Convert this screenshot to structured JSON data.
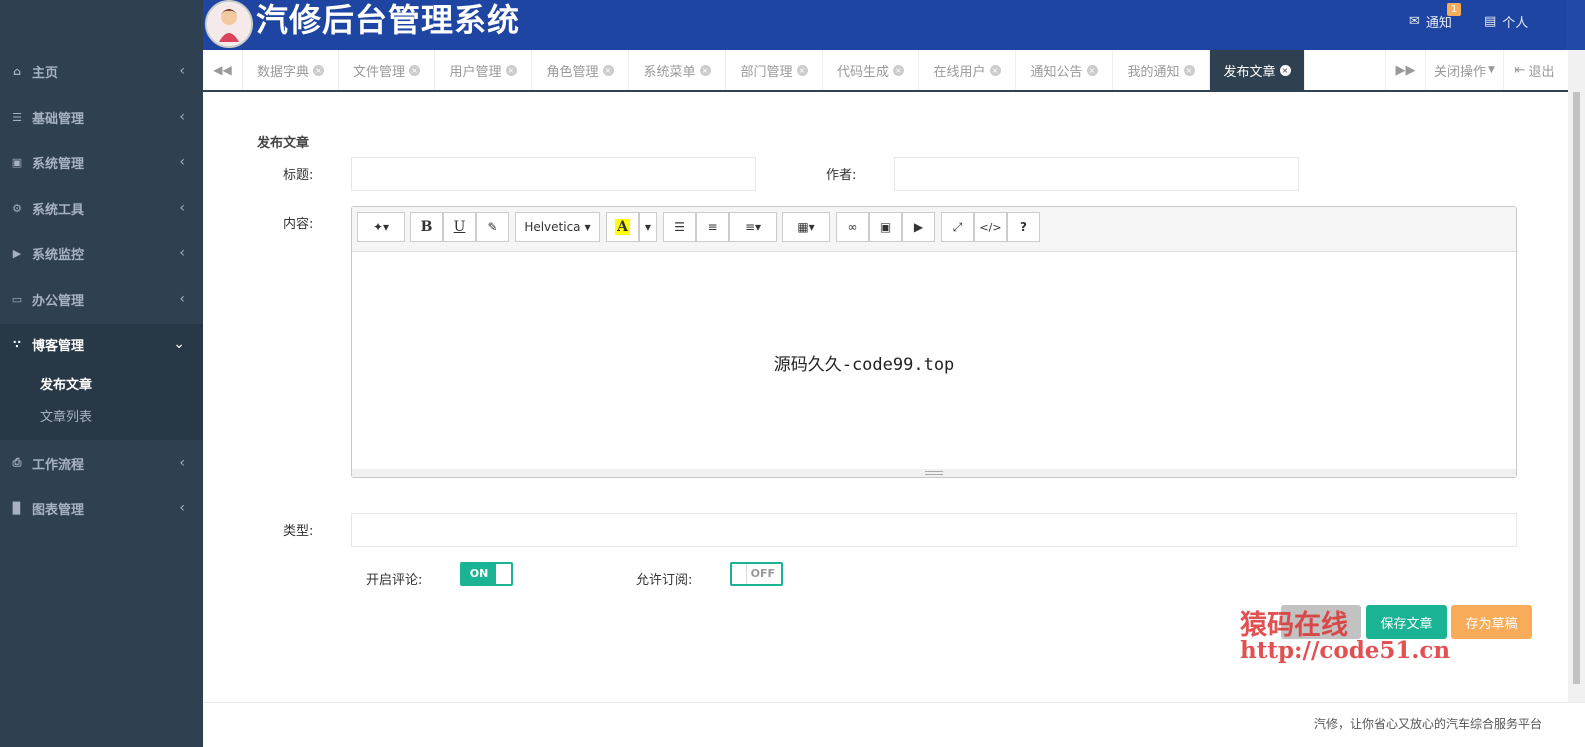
{
  "app": {
    "title": "汽修后台管理系统"
  },
  "header": {
    "notify_label": "通知",
    "notify_count": "1",
    "profile_label": "个人"
  },
  "sidebar": {
    "items": [
      {
        "label": "主页",
        "icon": "home-icon"
      },
      {
        "label": "基础管理",
        "icon": "list-icon"
      },
      {
        "label": "系统管理",
        "icon": "desktop-icon"
      },
      {
        "label": "系统工具",
        "icon": "gear-icon"
      },
      {
        "label": "系统监控",
        "icon": "video-icon"
      },
      {
        "label": "办公管理",
        "icon": "laptop-icon"
      },
      {
        "label": "博客管理",
        "icon": "rss-icon"
      },
      {
        "label": "工作流程",
        "icon": "print-icon"
      },
      {
        "label": "图表管理",
        "icon": "bar-chart-icon"
      }
    ],
    "blog_sub": [
      {
        "label": "发布文章"
      },
      {
        "label": "文章列表"
      }
    ]
  },
  "tabs": {
    "items": [
      {
        "label": "数据字典"
      },
      {
        "label": "文件管理"
      },
      {
        "label": "用户管理"
      },
      {
        "label": "角色管理"
      },
      {
        "label": "系统菜单"
      },
      {
        "label": "部门管理"
      },
      {
        "label": "代码生成"
      },
      {
        "label": "在线用户"
      },
      {
        "label": "通知公告"
      },
      {
        "label": "我的通知"
      },
      {
        "label": "发布文章"
      }
    ],
    "close_ops": "关闭操作",
    "logout": "退出"
  },
  "form": {
    "section_title": "发布文章",
    "title_label": "标题:",
    "author_label": "作者:",
    "content_label": "内容:",
    "type_label": "类型:",
    "comment_label": "开启评论:",
    "subscribe_label": "允许订阅:",
    "comment_toggle": "ON",
    "subscribe_toggle": "OFF",
    "title_value": "",
    "author_value": "",
    "type_value": ""
  },
  "editor": {
    "font_name": "Helvetica",
    "body_text": "源码久久-code99.top"
  },
  "buttons": {
    "save": "保存文章",
    "draft": "存为草稿"
  },
  "watermark": {
    "line1": "猿码在线",
    "line2": "http://code51.cn"
  },
  "footer": {
    "text": "汽修，让你省心又放心的汽车综合服务平台"
  },
  "colors": {
    "sidebar": "#2f4050",
    "header": "#1f45a3",
    "accent": "#1ab394",
    "warning": "#f8ac59"
  }
}
